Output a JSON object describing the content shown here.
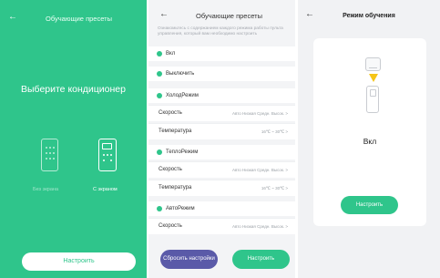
{
  "panel1": {
    "back_icon": "arrow-left-icon",
    "title": "Обучающие пресеты",
    "heading": "Выберите кондиционер",
    "option_no_screen": "Без экрана",
    "option_with_screen": "С экраном",
    "setup_button": "Настроить",
    "background_color": "#2fc58b"
  },
  "panel2": {
    "back_icon": "arrow-left-icon",
    "title": "Обучающие пресеты",
    "note": "Ознакомьтесь с содержанием каждого режима работы пульта управления, который вам необходимо настроить",
    "modes": [
      {
        "label": "Вкл"
      },
      {
        "label": "Выключить"
      },
      {
        "label": "ХолодРежим",
        "rows": [
          {
            "label": "Скорость",
            "value": "Авто Низкая Средн. Высок. >"
          },
          {
            "label": "Температура",
            "value": "16℃ ~ 30℃ >"
          }
        ]
      },
      {
        "label": "ТеплоРежим",
        "rows": [
          {
            "label": "Скорость",
            "value": "Авто Низкая Средн. Высок. >"
          },
          {
            "label": "Температура",
            "value": "16℃ ~ 30℃ >"
          }
        ]
      },
      {
        "label": "АвтоРежим",
        "rows": [
          {
            "label": "Скорость",
            "value": "Авто Низкая Средн. Высок. >"
          }
        ]
      }
    ],
    "reset_button": "Сбросить настройки",
    "setup_button": "Настроить",
    "accent_color": "#2fc58b",
    "reset_color": "#5a5aa8"
  },
  "panel3": {
    "back_icon": "arrow-left-icon",
    "title": "Режим обучения",
    "status": "Вкл",
    "setup_button": "Настроить"
  }
}
